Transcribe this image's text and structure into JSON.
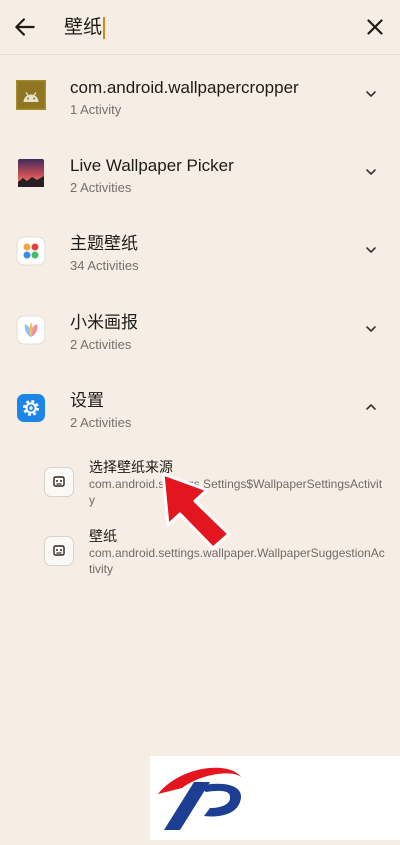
{
  "search": {
    "query": "壁纸"
  },
  "apps": [
    {
      "name": "com.android.wallpapercropper",
      "count": "1 Activity",
      "icon": "android-icon"
    },
    {
      "name": "Live Wallpaper Picker",
      "count": "2 Activities",
      "icon": "wallpaper-picker-icon"
    },
    {
      "name": "主题壁纸",
      "count": "34 Activities",
      "icon": "theme-wallpaper-icon"
    },
    {
      "name": "小米画报",
      "count": "2 Activities",
      "icon": "mi-pictorial-icon"
    },
    {
      "name": "设置",
      "count": "2 Activities",
      "icon": "settings-gear-icon",
      "expanded": true
    }
  ],
  "activities": [
    {
      "title": "选择壁纸来源",
      "class": "com.android.settings.Settings$WallpaperSettingsActivity"
    },
    {
      "title": "壁纸",
      "class": "com.android.settings.wallpaper.WallpaperSuggestionActivity"
    }
  ],
  "colors": {
    "background": "#f6eee4",
    "arrow": "#e3161f",
    "logo_blue": "#1c3f94",
    "logo_red": "#e3161f"
  }
}
